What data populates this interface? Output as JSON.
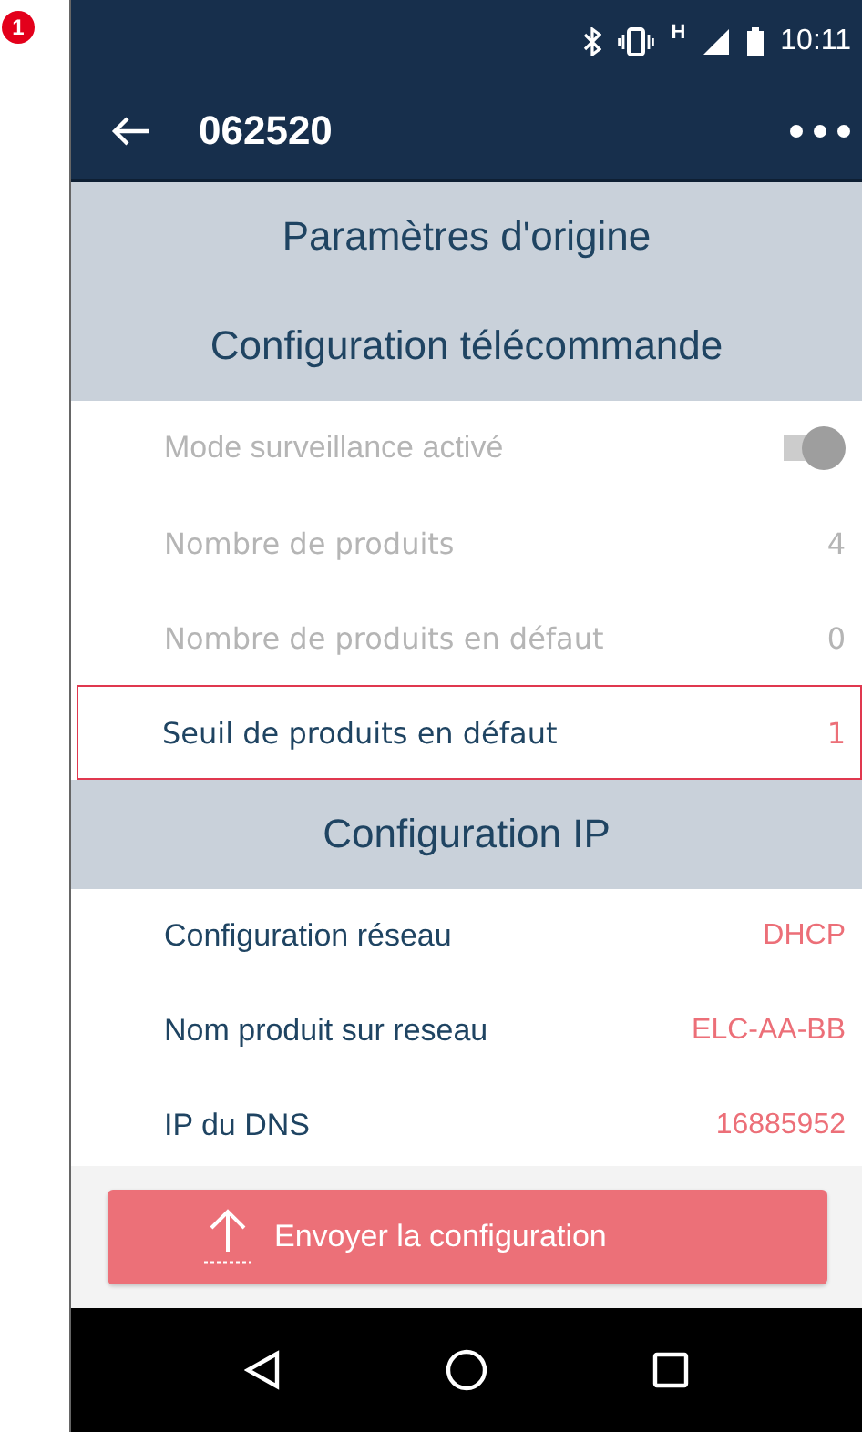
{
  "marker": "1",
  "status_bar": {
    "network": "H",
    "time": "10:11"
  },
  "app_bar": {
    "title": "062520"
  },
  "sections": [
    {
      "heading": "Paramètres d'origine"
    },
    {
      "heading": "Configuration télécommande",
      "rows": [
        {
          "kind": "toggle",
          "label": "Mode surveillance activé",
          "on": true,
          "disabled": true,
          "highlighted": false
        },
        {
          "kind": "value",
          "label": "Nombre de produits",
          "value": "4",
          "disabled": true,
          "highlighted": false
        },
        {
          "kind": "value",
          "label": "Nombre de produits en défaut",
          "value": "0",
          "disabled": true,
          "highlighted": false
        },
        {
          "kind": "value",
          "label": "Seuil de produits en défaut",
          "value": "1",
          "disabled": false,
          "highlighted": true
        }
      ]
    },
    {
      "heading": "Configuration IP",
      "rows": [
        {
          "kind": "value",
          "label": "Configuration réseau",
          "value": "DHCP",
          "disabled": false,
          "highlighted": false
        },
        {
          "kind": "value",
          "label": "Nom produit sur reseau",
          "value": "ELC-AA-BB",
          "disabled": false,
          "highlighted": false
        },
        {
          "kind": "value",
          "label": "IP du DNS",
          "value": "16885952",
          "disabled": false,
          "highlighted": false
        }
      ]
    }
  ],
  "send_button": {
    "label": "Envoyer la configuration"
  }
}
